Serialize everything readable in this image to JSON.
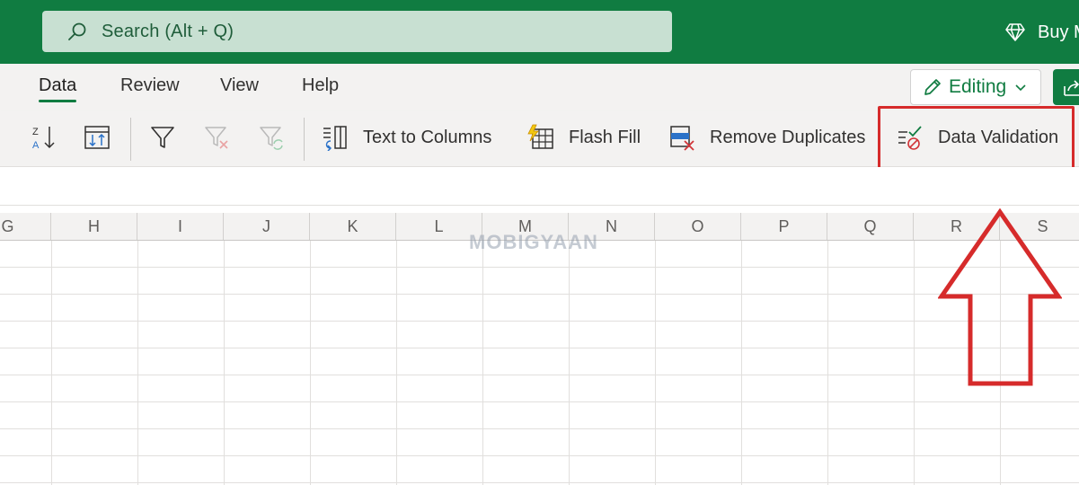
{
  "search": {
    "placeholder": "Search (Alt + Q)",
    "icon": "search-icon"
  },
  "header": {
    "buy_label": "Buy M",
    "buy_icon": "diamond-icon"
  },
  "tabs": [
    {
      "label": "Data",
      "active": true
    },
    {
      "label": "Review",
      "active": false
    },
    {
      "label": "View",
      "active": false
    },
    {
      "label": "Help",
      "active": false
    }
  ],
  "mode": {
    "label": "Editing",
    "icon": "pencil-icon"
  },
  "ribbon": {
    "text_to_columns": "Text to Columns",
    "flash_fill": "Flash Fill",
    "remove_duplicates": "Remove Duplicates",
    "data_validation": "Data Validation"
  },
  "columns": [
    "G",
    "H",
    "I",
    "J",
    "K",
    "L",
    "M",
    "N",
    "O",
    "P",
    "Q",
    "R",
    "S"
  ],
  "watermark": "MOBIGYAAN",
  "colors": {
    "brand_green": "#107c41",
    "highlight_red": "#d62b2b"
  }
}
